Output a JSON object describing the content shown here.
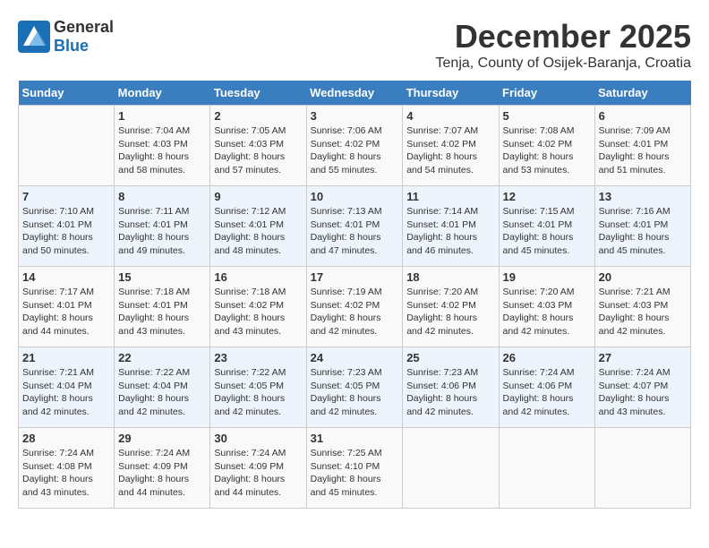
{
  "header": {
    "logo_general": "General",
    "logo_blue": "Blue",
    "month_title": "December 2025",
    "location": "Tenja, County of Osijek-Baranja, Croatia"
  },
  "days_of_week": [
    "Sunday",
    "Monday",
    "Tuesday",
    "Wednesday",
    "Thursday",
    "Friday",
    "Saturday"
  ],
  "weeks": [
    [
      {
        "day": "",
        "info": ""
      },
      {
        "day": "1",
        "info": "Sunrise: 7:04 AM\nSunset: 4:03 PM\nDaylight: 8 hours\nand 58 minutes."
      },
      {
        "day": "2",
        "info": "Sunrise: 7:05 AM\nSunset: 4:03 PM\nDaylight: 8 hours\nand 57 minutes."
      },
      {
        "day": "3",
        "info": "Sunrise: 7:06 AM\nSunset: 4:02 PM\nDaylight: 8 hours\nand 55 minutes."
      },
      {
        "day": "4",
        "info": "Sunrise: 7:07 AM\nSunset: 4:02 PM\nDaylight: 8 hours\nand 54 minutes."
      },
      {
        "day": "5",
        "info": "Sunrise: 7:08 AM\nSunset: 4:02 PM\nDaylight: 8 hours\nand 53 minutes."
      },
      {
        "day": "6",
        "info": "Sunrise: 7:09 AM\nSunset: 4:01 PM\nDaylight: 8 hours\nand 51 minutes."
      }
    ],
    [
      {
        "day": "7",
        "info": "Sunrise: 7:10 AM\nSunset: 4:01 PM\nDaylight: 8 hours\nand 50 minutes."
      },
      {
        "day": "8",
        "info": "Sunrise: 7:11 AM\nSunset: 4:01 PM\nDaylight: 8 hours\nand 49 minutes."
      },
      {
        "day": "9",
        "info": "Sunrise: 7:12 AM\nSunset: 4:01 PM\nDaylight: 8 hours\nand 48 minutes."
      },
      {
        "day": "10",
        "info": "Sunrise: 7:13 AM\nSunset: 4:01 PM\nDaylight: 8 hours\nand 47 minutes."
      },
      {
        "day": "11",
        "info": "Sunrise: 7:14 AM\nSunset: 4:01 PM\nDaylight: 8 hours\nand 46 minutes."
      },
      {
        "day": "12",
        "info": "Sunrise: 7:15 AM\nSunset: 4:01 PM\nDaylight: 8 hours\nand 45 minutes."
      },
      {
        "day": "13",
        "info": "Sunrise: 7:16 AM\nSunset: 4:01 PM\nDaylight: 8 hours\nand 45 minutes."
      }
    ],
    [
      {
        "day": "14",
        "info": "Sunrise: 7:17 AM\nSunset: 4:01 PM\nDaylight: 8 hours\nand 44 minutes."
      },
      {
        "day": "15",
        "info": "Sunrise: 7:18 AM\nSunset: 4:01 PM\nDaylight: 8 hours\nand 43 minutes."
      },
      {
        "day": "16",
        "info": "Sunrise: 7:18 AM\nSunset: 4:02 PM\nDaylight: 8 hours\nand 43 minutes."
      },
      {
        "day": "17",
        "info": "Sunrise: 7:19 AM\nSunset: 4:02 PM\nDaylight: 8 hours\nand 42 minutes."
      },
      {
        "day": "18",
        "info": "Sunrise: 7:20 AM\nSunset: 4:02 PM\nDaylight: 8 hours\nand 42 minutes."
      },
      {
        "day": "19",
        "info": "Sunrise: 7:20 AM\nSunset: 4:03 PM\nDaylight: 8 hours\nand 42 minutes."
      },
      {
        "day": "20",
        "info": "Sunrise: 7:21 AM\nSunset: 4:03 PM\nDaylight: 8 hours\nand 42 minutes."
      }
    ],
    [
      {
        "day": "21",
        "info": "Sunrise: 7:21 AM\nSunset: 4:04 PM\nDaylight: 8 hours\nand 42 minutes."
      },
      {
        "day": "22",
        "info": "Sunrise: 7:22 AM\nSunset: 4:04 PM\nDaylight: 8 hours\nand 42 minutes."
      },
      {
        "day": "23",
        "info": "Sunrise: 7:22 AM\nSunset: 4:05 PM\nDaylight: 8 hours\nand 42 minutes."
      },
      {
        "day": "24",
        "info": "Sunrise: 7:23 AM\nSunset: 4:05 PM\nDaylight: 8 hours\nand 42 minutes."
      },
      {
        "day": "25",
        "info": "Sunrise: 7:23 AM\nSunset: 4:06 PM\nDaylight: 8 hours\nand 42 minutes."
      },
      {
        "day": "26",
        "info": "Sunrise: 7:24 AM\nSunset: 4:06 PM\nDaylight: 8 hours\nand 42 minutes."
      },
      {
        "day": "27",
        "info": "Sunrise: 7:24 AM\nSunset: 4:07 PM\nDaylight: 8 hours\nand 43 minutes."
      }
    ],
    [
      {
        "day": "28",
        "info": "Sunrise: 7:24 AM\nSunset: 4:08 PM\nDaylight: 8 hours\nand 43 minutes."
      },
      {
        "day": "29",
        "info": "Sunrise: 7:24 AM\nSunset: 4:09 PM\nDaylight: 8 hours\nand 44 minutes."
      },
      {
        "day": "30",
        "info": "Sunrise: 7:24 AM\nSunset: 4:09 PM\nDaylight: 8 hours\nand 44 minutes."
      },
      {
        "day": "31",
        "info": "Sunrise: 7:25 AM\nSunset: 4:10 PM\nDaylight: 8 hours\nand 45 minutes."
      },
      {
        "day": "",
        "info": ""
      },
      {
        "day": "",
        "info": ""
      },
      {
        "day": "",
        "info": ""
      }
    ]
  ]
}
